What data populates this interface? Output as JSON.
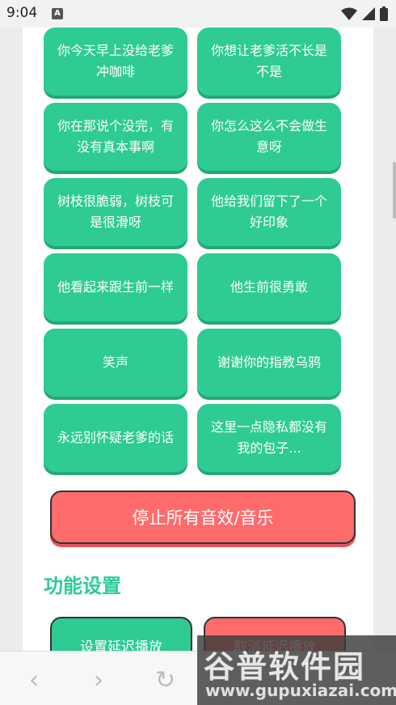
{
  "status_bar": {
    "time": "9:04",
    "notification_letter": "A",
    "icons": [
      "wifi-icon",
      "signal-icon",
      "battery-icon"
    ]
  },
  "sound_buttons": [
    "你今天早上没给老爹冲咖啡",
    "你想让老爹活不长是不是",
    "你在那说个没完，有没有真本事啊",
    "你怎么这么不会做生意呀",
    "树枝很脆弱，树枝可是很滑呀",
    "他给我们留下了一个好印象",
    "他看起来跟生前一样",
    "他生前很勇敢",
    "笑声",
    "谢谢你的指教乌鸦",
    "永远别怀疑老爹的话",
    "这里一点隐私都没有我的包子..."
  ],
  "stop_button": "停止所有音效/音乐",
  "settings": {
    "title": "功能设置",
    "set_delay": "设置延迟播放",
    "cancel_delay": "取消延迟播放"
  },
  "bottom_nav": {
    "back": "‹",
    "forward": "›",
    "reload": "↻"
  },
  "watermark": {
    "title": "谷普软件园",
    "url": "www.gupuxiazai.com"
  },
  "colors": {
    "green": "#2ecb93",
    "red": "#ff6b6b"
  }
}
